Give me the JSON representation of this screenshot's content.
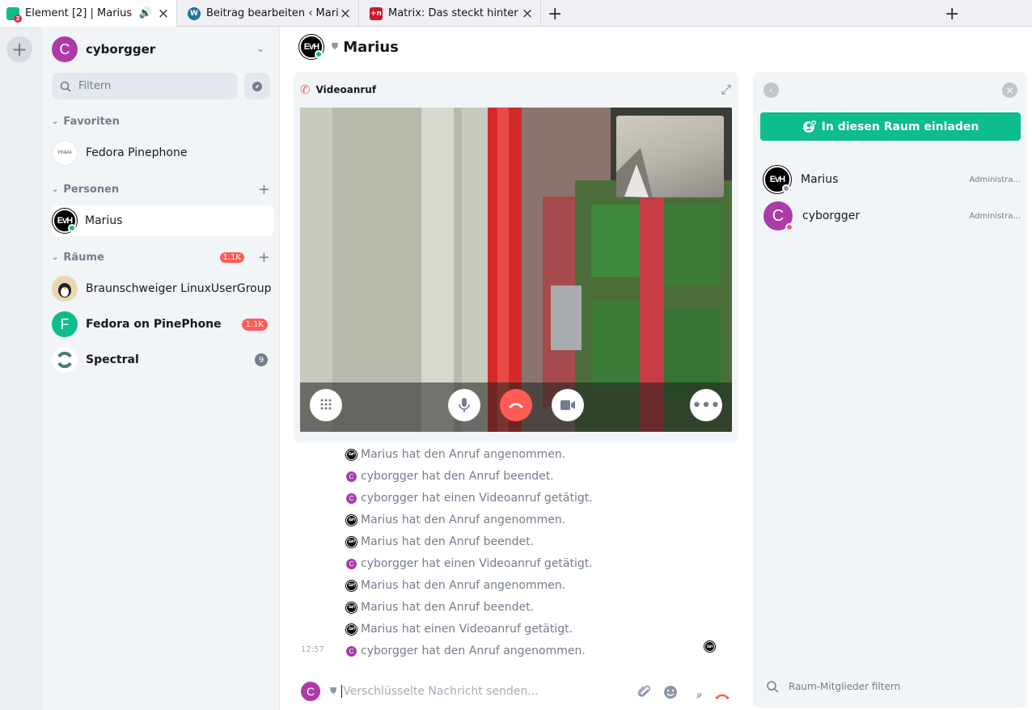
{
  "browser": {
    "tabs": [
      {
        "title": "Element [2] | Marius",
        "favicon": "element-icon",
        "badge": "2",
        "active": true
      },
      {
        "title": "Beitrag bearbeiten ‹ Mariu",
        "favicon": "wordpress-icon",
        "active": false
      },
      {
        "title": "Matrix: Das steckt hinter d",
        "favicon": "heise-icon",
        "favicon_text": "+n",
        "active": false
      }
    ],
    "new_tab": "+"
  },
  "sidebar": {
    "user": {
      "initial": "C",
      "name": "cyborgger"
    },
    "filter_placeholder": "Filtern",
    "sections": {
      "favorites": {
        "label": "Favoriten"
      },
      "people": {
        "label": "Personen"
      },
      "rooms": {
        "label": "Räume",
        "count": "1.1K"
      }
    },
    "favorites": [
      {
        "name": "Fedora Pinephone",
        "avatar_text": "PINE64"
      }
    ],
    "people": [
      {
        "name": "Marius",
        "avatar_text": "EvH"
      }
    ],
    "rooms": [
      {
        "name": "Braunschweiger LinuxUserGroup"
      },
      {
        "name": "Fedora on PinePhone",
        "initial": "F",
        "badge": "1.1K"
      },
      {
        "name": "Spectral",
        "badge": "9"
      }
    ]
  },
  "room": {
    "avatar_text": "EvH",
    "title": "Marius",
    "call": {
      "label": "Videoanruf"
    },
    "events": [
      "Marius hat den Anruf angenommen.",
      "cyborgger hat den Anruf beendet.",
      "cyborgger hat einen Videoanruf getätigt.",
      "Marius hat den Anruf angenommen.",
      "Marius hat den Anruf beendet.",
      "cyborgger hat einen Videoanruf getätigt.",
      "Marius hat den Anruf angenommen.",
      "Marius hat den Anruf beendet.",
      "Marius hat einen Videoanruf getätigt.",
      "cyborgger hat den Anruf angenommen."
    ],
    "event_authors": [
      "m",
      "c",
      "c",
      "m",
      "m",
      "c",
      "m",
      "m",
      "m",
      "c"
    ],
    "last_timestamp": "12:57",
    "composer_placeholder": "Verschlüsselte Nachricht senden..."
  },
  "right_panel": {
    "invite_label": "In diesen Raum einladen",
    "members": [
      {
        "name": "Marius",
        "role": "Administra...",
        "avatar_text": "EvH"
      },
      {
        "name": "cyborgger",
        "role": "Administra...",
        "initial": "C"
      }
    ],
    "filter_placeholder": "Raum-Mitglieder filtern"
  },
  "colors": {
    "accent": "#0dbd8b",
    "alert": "#ff5b55",
    "avatar_c": "#ac3ba8"
  }
}
